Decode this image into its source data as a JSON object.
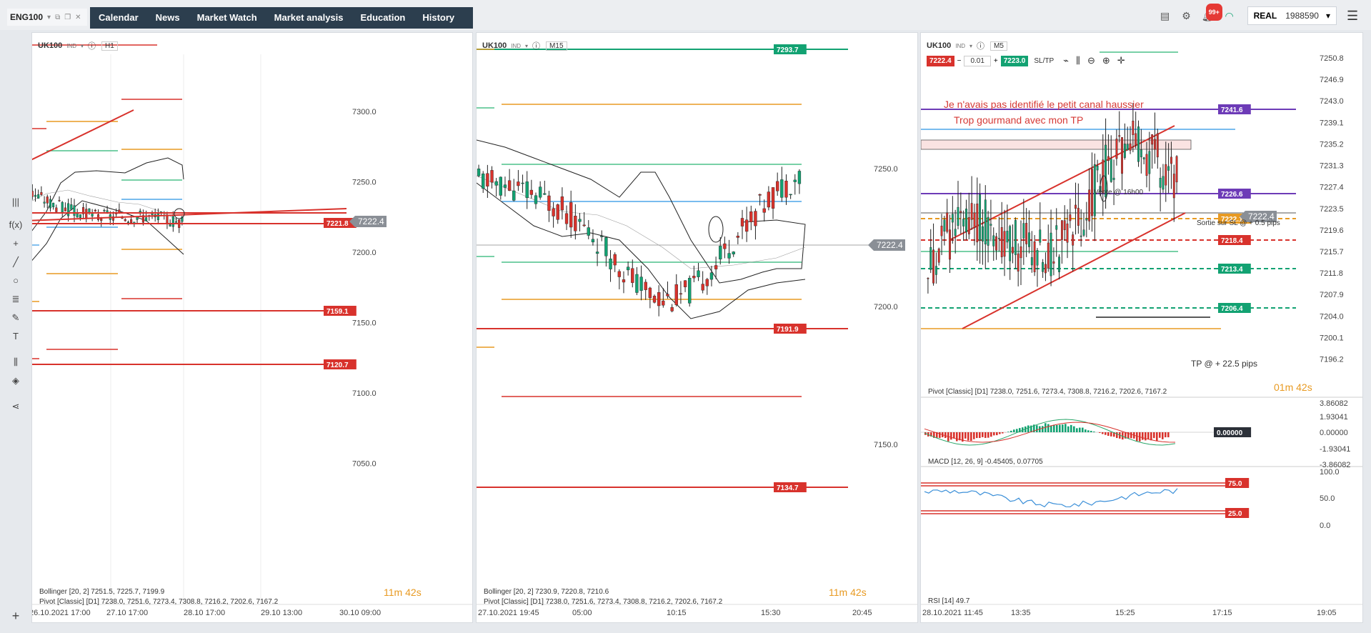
{
  "topbar": {
    "symbol_tab": "ENG100",
    "nav": [
      "Calendar",
      "News",
      "Market Watch",
      "Market analysis",
      "Education",
      "History"
    ],
    "notifications_badge": "99+",
    "account_type": "REAL",
    "account_number": "1988590"
  },
  "charts": [
    {
      "symbol": "UK100",
      "sub": "IND",
      "timeframe": "H1",
      "price_tag": "7222.4",
      "y_ticks": [
        "7300.0",
        "7250.0",
        "7200.0",
        "7150.0",
        "7100.0",
        "7050.0"
      ],
      "x_ticks": [
        "26.10.2021 17:00",
        "27.10 17:00",
        "28.10 17:00",
        "29.10 13:00",
        "30.10 09:00"
      ],
      "level_tags": [
        "7221.8",
        "7159.1",
        "7120.7"
      ],
      "indicators": [
        "Bollinger [20, 2] 7251.5, 7225.7, 7199.9",
        "Pivot [Classic] [D1] 7238.0, 7251.6, 7273.4, 7308.8, 7216.2, 7202.6, 7167.2"
      ],
      "timer_min": "11",
      "timer_sec": "42"
    },
    {
      "symbol": "UK100",
      "sub": "IND",
      "timeframe": "M15",
      "price_tag": "7222.4",
      "y_ticks": [
        "7250.0",
        "7200.0",
        "7150.0"
      ],
      "x_ticks": [
        "27.10.2021 19:45",
        "05:00",
        "10:15",
        "15:30",
        "20:45"
      ],
      "level_tags": [
        "7293.7",
        "7191.9",
        "7134.7"
      ],
      "indicators": [
        "Bollinger [20, 2] 7230.9, 7220.8, 7210.6",
        "Pivot [Classic] [D1] 7238.0, 7251.6, 7273.4, 7308.8, 7216.2, 7202.6, 7167.2"
      ],
      "timer_min": "11",
      "timer_sec": "42"
    },
    {
      "symbol": "UK100",
      "sub": "IND",
      "timeframe": "M5",
      "sell_price": "7222.4",
      "lot": "0.01",
      "buy_price": "7223.0",
      "sltp": "SL/TP",
      "price_tag": "7222.4",
      "y_ticks": [
        "7250.8",
        "7246.9",
        "7243.0",
        "7239.1",
        "7235.2",
        "7231.3",
        "7227.4",
        "7223.5",
        "7219.6",
        "7215.7",
        "7211.8",
        "7207.9",
        "7204.0",
        "7200.1",
        "7196.2"
      ],
      "x_ticks": [
        "28.10.2021 11:45",
        "13:35",
        "15:25",
        "17:15",
        "19:05"
      ],
      "level_tags": [
        "7241.6",
        "7226.6",
        "7222.1",
        "7218.4",
        "7213.4",
        "7206.4"
      ],
      "annotation_line1": "Je n'avais pas identifié le petit canal haussier",
      "annotation_line2": "Trop gourmand avec mon TP",
      "note_vente": "Vente @ 16h00",
      "note_sortie": "Sortie sur SL @ + 0.5 pips",
      "note_tp": "TP @ + 22.5 pips",
      "pivot_label": "Pivot [Classic] [D1] 7238.0, 7251.6, 7273.4, 7308.8, 7216.2, 7202.6, 7167.2",
      "timer_min": "01",
      "timer_sec": "42",
      "macd_label": "MACD [12, 26, 9] -0.45405, 0.07705",
      "macd_ticks": [
        "3.86082",
        "1.93041",
        "0.00000",
        "-1.93041",
        "-3.86082"
      ],
      "macd_tag": "0.00000",
      "rsi_label": "RSI [14] 49.7",
      "rsi_ticks": [
        "100.0",
        "50.0",
        "0.0"
      ],
      "rsi_tags": [
        "75.0",
        "25.0"
      ]
    }
  ],
  "colors": {
    "red": "#d8322c",
    "green": "#12a272",
    "purple": "#6d3bb7",
    "orange": "#e89a22",
    "grey_tag": "#8a8f96",
    "nav_bg": "#2c3e4e"
  },
  "icons": [
    "dropdown-icon",
    "popout-icon",
    "restore-icon",
    "close-icon",
    "layout-icon",
    "signal-icon",
    "bell-icon",
    "wifi-icon",
    "menu-icon",
    "info-icon",
    "crosshair-icon",
    "zoom-in-icon",
    "zoom-out-icon",
    "plus-icon"
  ]
}
